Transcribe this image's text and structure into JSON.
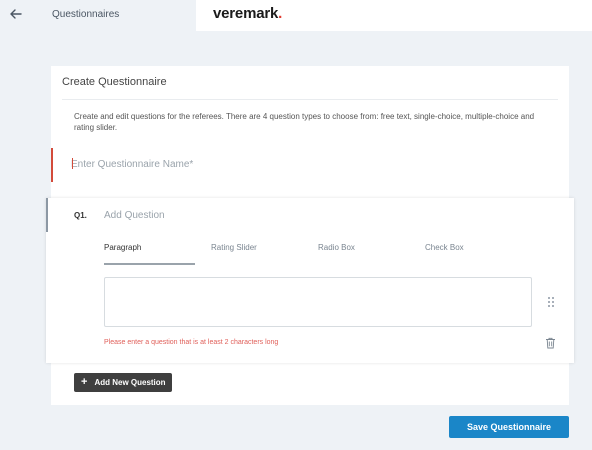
{
  "header": {
    "back_icon": "arrow-left-icon",
    "title": "Questionnaires",
    "logo_text": "veremark",
    "logo_dot": ".",
    "logo_dot_color": "#e03a2f"
  },
  "card": {
    "title": "Create Questionnaire",
    "description": "Create and edit questions for the referees. There are 4 question types to choose from: free text, single-choice, multiple-choice and rating slider.",
    "name_input": {
      "value": "",
      "placeholder": "Enter Questionnaire Name*"
    }
  },
  "question": {
    "number": "Q1.",
    "input": {
      "value": "",
      "placeholder": "Add Question"
    },
    "tabs": [
      {
        "label": "Paragraph",
        "active": true
      },
      {
        "label": "Rating Slider",
        "active": false
      },
      {
        "label": "Radio Box",
        "active": false
      },
      {
        "label": "Check Box",
        "active": false
      }
    ],
    "answer_value": "",
    "error": "Please enter a question that is at least 2 characters long",
    "drag_icon": "drag-handle-icon",
    "delete_icon": "trash-icon"
  },
  "actions": {
    "add_label": "Add New Question",
    "add_icon": "+",
    "save_label": "Save Questionnaire"
  },
  "colors": {
    "accent": "#1a86c8",
    "error": "#e0605a",
    "required_marker": "#d34b3a",
    "dark_button": "#3f3f3f"
  }
}
